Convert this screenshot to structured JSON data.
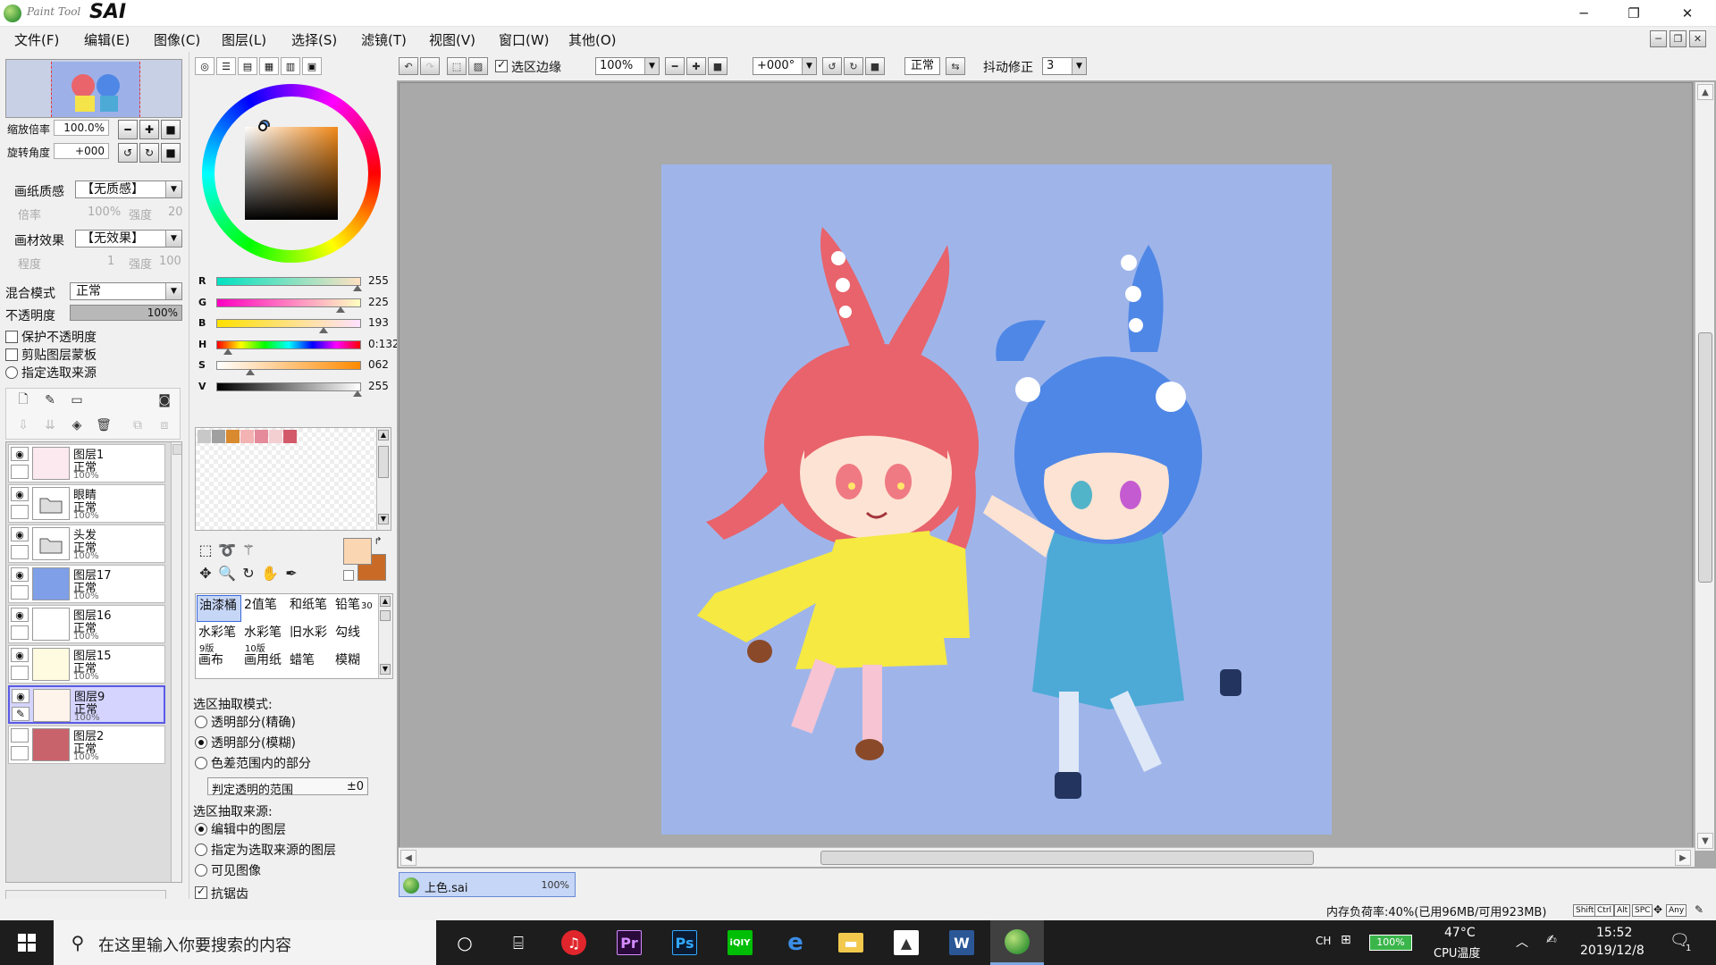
{
  "app": {
    "title_small": "Paint Tool",
    "title_big": "SAI"
  },
  "window_buttons": {
    "minimize": "─",
    "restore": "❐",
    "close": "✕"
  },
  "menu": [
    "文件(F)",
    "编辑(E)",
    "图像(C)",
    "图层(L)",
    "选择(S)",
    "滤镜(T)",
    "视图(V)",
    "窗口(W)",
    "其他(O)"
  ],
  "nav": {
    "zoom_label": "缩放倍率",
    "zoom_value": "100.0%",
    "angle_label": "旋转角度",
    "angle_value": "+000"
  },
  "texture": {
    "paper_label": "画纸质感",
    "paper_value": "【无质感】",
    "scale_label": "倍率",
    "scale_value": "100%",
    "strength_label": "强度",
    "strength_value": "20",
    "effect_label": "画材效果",
    "effect_value": "【无效果】",
    "degree_label": "程度",
    "degree_value": "1",
    "strength2_label": "强度",
    "strength2_value": "100"
  },
  "blend": {
    "label": "混合模式",
    "value": "正常",
    "opacity_label": "不透明度",
    "opacity_value": "100%"
  },
  "layer_checks": {
    "protect": "保护不透明度",
    "clip": "剪贴图层蒙板",
    "source": "指定选取来源"
  },
  "layers": [
    {
      "name": "图层1",
      "mode": "正常",
      "opacity": "100%",
      "visible": true,
      "thumb": "#fbe9ef"
    },
    {
      "name": "眼睛",
      "mode": "正常",
      "opacity": "100%",
      "visible": true,
      "thumb": "folder"
    },
    {
      "name": "头发",
      "mode": "正常",
      "opacity": "100%",
      "visible": true,
      "thumb": "folder"
    },
    {
      "name": "图层17",
      "mode": "正常",
      "opacity": "100%",
      "visible": true,
      "thumb": "#7fa0e8"
    },
    {
      "name": "图层16",
      "mode": "正常",
      "opacity": "100%",
      "visible": true,
      "thumb": "#ffffff"
    },
    {
      "name": "图层15",
      "mode": "正常",
      "opacity": "100%",
      "visible": true,
      "thumb": "#fffbe0"
    },
    {
      "name": "图层9",
      "mode": "正常",
      "opacity": "100%",
      "visible": true,
      "thumb": "#fff4ec"
    },
    {
      "name": "图层2",
      "mode": "正常",
      "opacity": "100%",
      "visible": false,
      "thumb": "#c9636b"
    }
  ],
  "color": {
    "sliders": [
      {
        "label": "R",
        "value": "255",
        "grad": "linear-gradient(to right,#00e1c1,#ffe1c1)",
        "pos": 1.0
      },
      {
        "label": "G",
        "value": "225",
        "grad": "linear-gradient(to right,#ff00c1,#ffffc1)",
        "pos": 0.88
      },
      {
        "label": "B",
        "value": "193",
        "grad": "linear-gradient(to right,#ffe100,#ffe1ff)",
        "pos": 0.76
      },
      {
        "label": "H",
        "value": "0:132",
        "grad": "linear-gradient(to right,#f00,#ff0,#0f0,#0ff,#00f,#f0f,#f00)",
        "pos": 0.08
      },
      {
        "label": "S",
        "value": "062",
        "grad": "linear-gradient(to right,#ffffff,#ff8a00)",
        "pos": 0.24
      },
      {
        "label": "V",
        "value": "255",
        "grad": "linear-gradient(to right,#000000,#ffffff)",
        "pos": 1.0
      }
    ],
    "swatches": [
      "#c8c8c8",
      "#a0a0a0",
      "#d9892e",
      "#f4b3b3",
      "#e58a9a",
      "#f3cfd2",
      "#d25a6a"
    ],
    "fg": "#fbd6b2",
    "bg": "#c96b26"
  },
  "brushes": [
    {
      "name": "油漆桶",
      "size": ""
    },
    {
      "name": "2值笔",
      "size": ""
    },
    {
      "name": "和纸笔",
      "size": ""
    },
    {
      "name": "铅笔",
      "size": "30"
    },
    {
      "name": "水彩笔",
      "size": "9版"
    },
    {
      "name": "水彩笔",
      "size": "10版"
    },
    {
      "name": "旧水彩",
      "size": ""
    },
    {
      "name": "勾线",
      "size": ""
    },
    {
      "name": "画布",
      "size": ""
    },
    {
      "name": "画用纸",
      "size": ""
    },
    {
      "name": "蜡笔",
      "size": ""
    },
    {
      "name": "模糊",
      "size": ""
    }
  ],
  "selection": {
    "mode_title": "选区抽取模式:",
    "opt1": "透明部分(精确)",
    "opt2": "透明部分(模糊)",
    "opt3": "色差范围内的部分",
    "range_label": "判定透明的范围",
    "range_value": "±0",
    "source_title": "选区抽取来源:",
    "src1": "编辑中的图层",
    "src2": "指定为选取来源的图层",
    "src3": "可见图像",
    "cut": "抗锯齿"
  },
  "toolbar": {
    "sel_edge": "选区边缘",
    "zoom": "100%",
    "angle": "+000°",
    "mode": "正常",
    "stab_label": "抖动修正",
    "stab_value": "3"
  },
  "file_tab": {
    "name": "上色.sai",
    "zoom": "100%"
  },
  "status": {
    "memory": "内存负荷率:40%(已用96MB/可用923MB)",
    "keys": [
      "Shift",
      "Ctrl",
      "Alt",
      "SPC",
      "Any"
    ]
  },
  "taskbar": {
    "search_placeholder": "在这里输入你要搜索的内容",
    "ime": "CH",
    "battery": "100%",
    "temp": "47°C",
    "temp_label": "CPU温度",
    "time": "15:52",
    "date": "2019/12/8",
    "notif": "1"
  }
}
